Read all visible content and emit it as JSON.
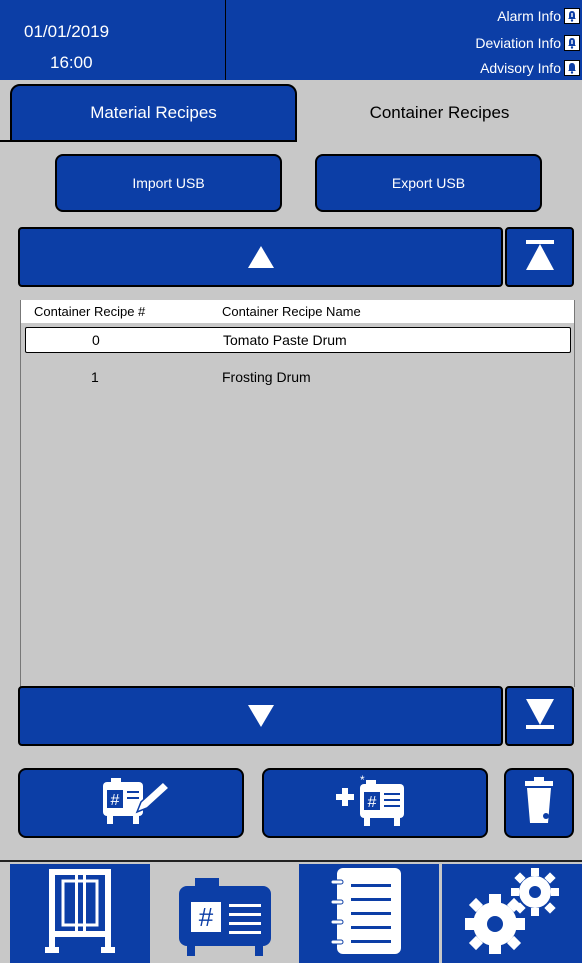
{
  "header": {
    "date": "01/01/2019",
    "time": "16:00",
    "alarm_info": "Alarm Info",
    "deviation_info": "Deviation Info",
    "advisory_info": "Advisory Info"
  },
  "tabs": {
    "material": "Material Recipes",
    "container": "Container Recipes"
  },
  "buttons": {
    "import_usb": "Import USB",
    "export_usb": "Export USB"
  },
  "table": {
    "col_number": "Container Recipe #",
    "col_name": "Container Recipe Name",
    "rows": [
      {
        "number": "0",
        "name": "Tomato Paste Drum"
      },
      {
        "number": "1",
        "name": "Frosting Drum"
      }
    ]
  },
  "colors": {
    "accent": "#0c3ea6",
    "background": "#c8c8c8"
  },
  "icons": {
    "scroll_up": "triangle-up-icon",
    "scroll_top": "scroll-to-top-icon",
    "scroll_down": "triangle-down-icon",
    "scroll_bottom": "scroll-to-bottom-icon",
    "edit_recipe": "edit-recipe-icon",
    "add_recipe": "add-recipe-icon",
    "delete_recipe": "trash-can-icon",
    "nav_machine": "machine-icon",
    "nav_recipes": "recipes-icon",
    "nav_log": "log-notebook-icon",
    "nav_settings": "gears-icon"
  }
}
